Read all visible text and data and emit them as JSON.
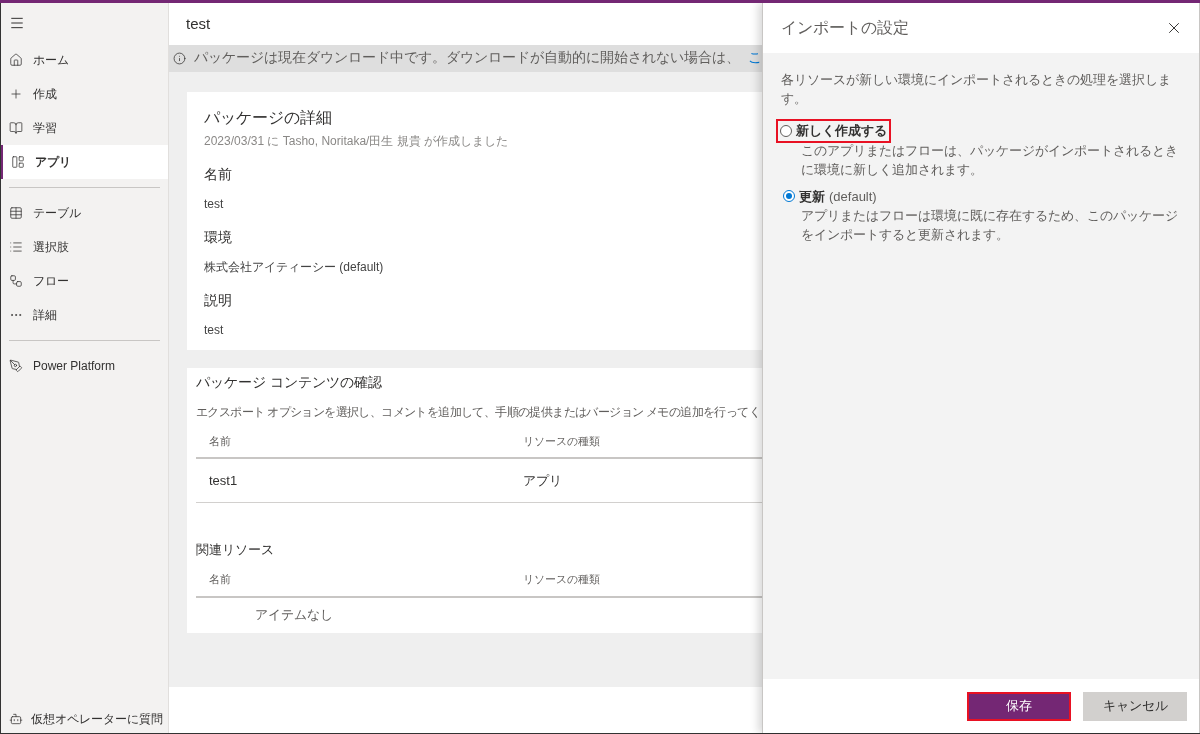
{
  "sidebar": {
    "items": [
      {
        "kind": "home",
        "label": "ホーム",
        "selected": false
      },
      {
        "kind": "plus",
        "label": "作成",
        "selected": false
      },
      {
        "kind": "book",
        "label": "学習",
        "selected": false
      },
      {
        "kind": "apps",
        "label": "アプリ",
        "selected": true
      },
      {
        "kind": "divider"
      },
      {
        "kind": "table",
        "label": "テーブル",
        "selected": false
      },
      {
        "kind": "list",
        "label": "選択肢",
        "selected": false
      },
      {
        "kind": "flow",
        "label": "フロー",
        "selected": false
      },
      {
        "kind": "more",
        "label": "詳細",
        "selected": false
      },
      {
        "kind": "divider"
      },
      {
        "kind": "platform",
        "label": "Power Platform",
        "selected": false
      }
    ],
    "bottom": "仮想オペレーターに質問"
  },
  "page_title": "test",
  "banner": {
    "text": "パッケージは現在ダウンロード中です。ダウンロードが自動的に開始されない場合は、",
    "link": "こ"
  },
  "details": {
    "title": "パッケージの詳細",
    "subtitle": "2023/03/31 に Tasho, Noritaka/田生 規貴 が作成しました",
    "fields": [
      {
        "label": "名前",
        "value": "test"
      },
      {
        "label": "環境",
        "value": "株式会社アイティーシー (default)"
      },
      {
        "label": "説明",
        "value": "test"
      }
    ]
  },
  "contents": {
    "title": "パッケージ コンテンツの確認",
    "description": "エクスポート オプションを選択し、コメントを追加して、手順の提供またはバージョン メモの追加を行ってく",
    "table": {
      "columns": [
        "名前",
        "リソースの種類"
      ],
      "rows": [
        [
          "test1",
          "アプリ"
        ]
      ]
    },
    "related_title": "関連リソース",
    "related_table": {
      "columns": [
        "名前",
        "リソースの種類"
      ],
      "empty": "アイテムなし"
    }
  },
  "panel": {
    "title": "インポートの設定",
    "intro": "各リソースが新しい環境にインポートされるときの処理を選択します。",
    "options": [
      {
        "label": "新しく作成する",
        "description": "このアプリまたはフローは、パッケージがインポートされるときに環境に新しく追加されます。",
        "selected": false,
        "highlighted": true
      },
      {
        "label": "更新",
        "suffix": " (default)",
        "description": "アプリまたはフローは環境に既に存在するため、このパッケージをインポートすると更新されます。",
        "selected": true,
        "highlighted": false
      }
    ],
    "buttons": [
      {
        "kind": "primary",
        "label": "保存",
        "highlighted": true
      },
      {
        "kind": "secondary",
        "label": "キャンセル",
        "highlighted": false
      }
    ]
  }
}
